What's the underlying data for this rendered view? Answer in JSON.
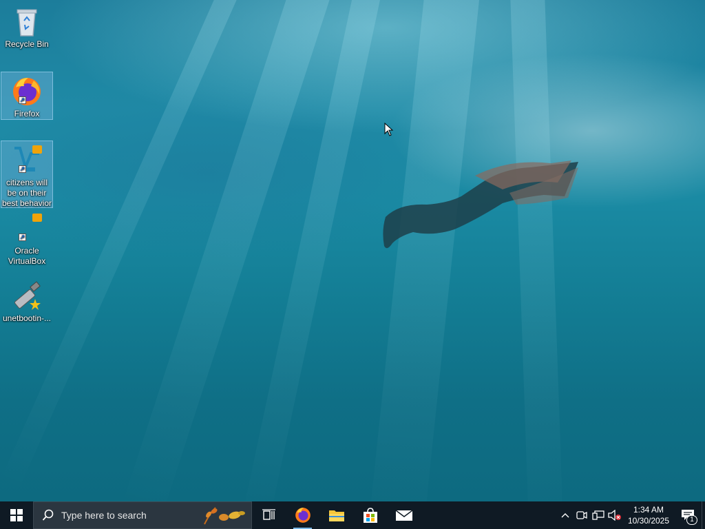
{
  "desktop": {
    "icons": [
      {
        "label": "Recycle Bin",
        "icon": "recycle-bin-icon"
      },
      {
        "label": "Firefox",
        "icon": "firefox-icon"
      },
      {
        "label": "citizens will be on their best behavior",
        "icon": "virtualbox-icon"
      },
      {
        "label": "Oracle VirtualBox",
        "icon": "virtualbox-icon"
      },
      {
        "label": "unetbootin-...",
        "icon": "unetbootin-icon"
      }
    ]
  },
  "taskbar": {
    "start_icon": "windows-logo-icon",
    "search_placeholder": "Type here to search",
    "apps": [
      {
        "name": "Task View",
        "icon": "task-view-icon"
      },
      {
        "name": "Firefox",
        "icon": "firefox-icon"
      },
      {
        "name": "File Explorer",
        "icon": "folder-icon"
      },
      {
        "name": "Microsoft Store",
        "icon": "store-icon"
      },
      {
        "name": "Mail",
        "icon": "mail-icon"
      }
    ],
    "tray": {
      "time": "1:34 AM",
      "date": "10/30/2025",
      "notification_count": "1"
    }
  },
  "colors": {
    "taskbar": "#0f1a24",
    "search_box": "#2b3640",
    "water_light": "#3fb0c8",
    "water_dark": "#0d6a80"
  }
}
